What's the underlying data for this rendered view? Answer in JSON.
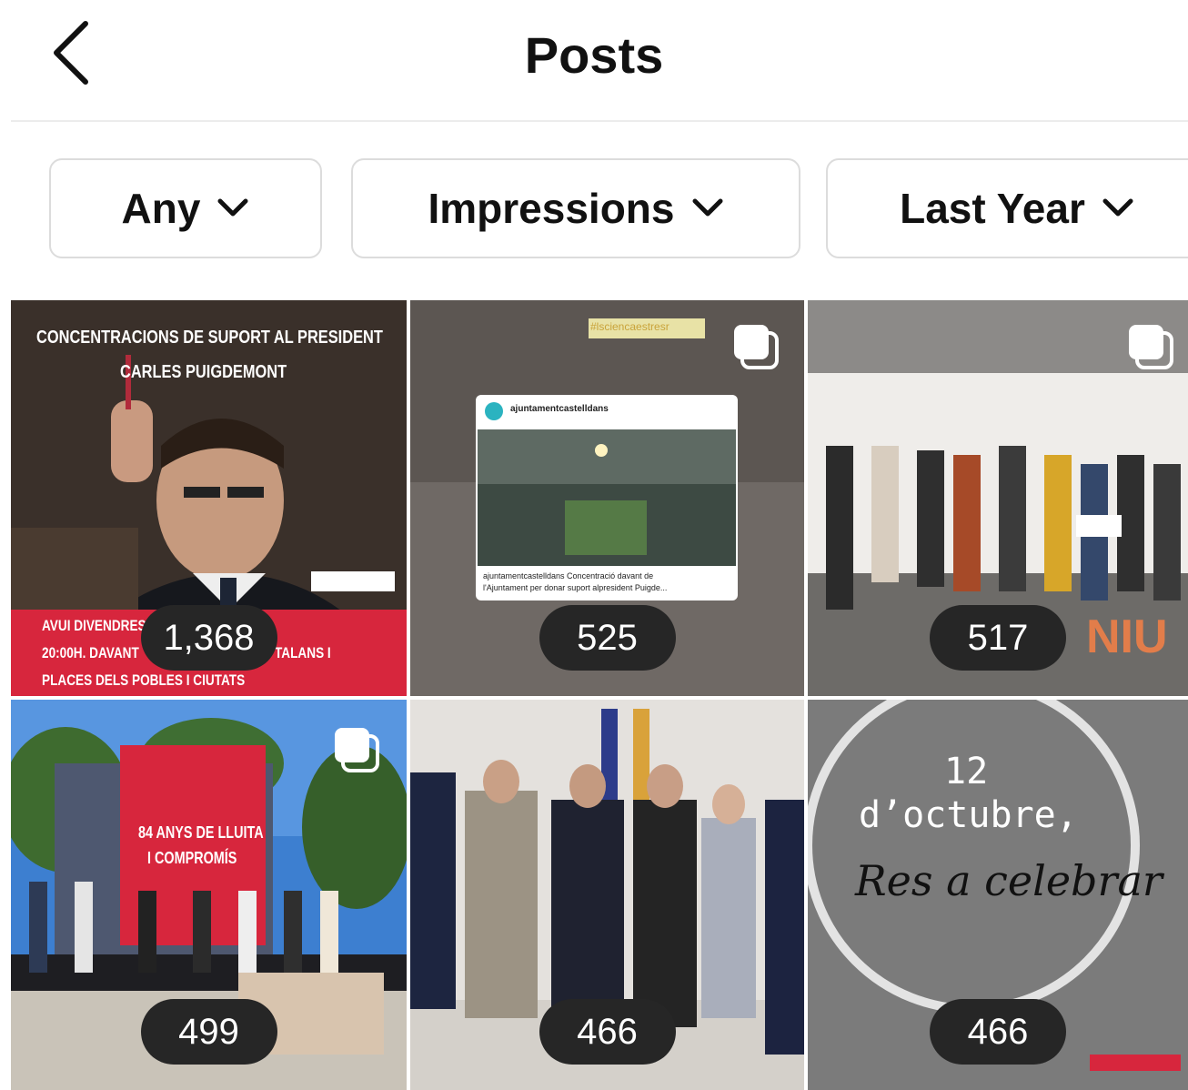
{
  "header": {
    "title": "Posts"
  },
  "filters": [
    {
      "label": "Any"
    },
    {
      "label": "Impressions"
    },
    {
      "label": "Last Year"
    }
  ],
  "posts": [
    {
      "count": "1,368",
      "text": {
        "headline1": "CONCENTRACIONS DE SUPORT AL PRESIDENT",
        "headline2": "CARLES PUIGDEMONT",
        "footer1": "AVUI DIVENDRES",
        "footer2a": "20:00H. DAVANT",
        "footer2b": "TALANS I",
        "footer3": "PLACES DELS POBLES I CIUTATS"
      }
    },
    {
      "count": "525",
      "text": {
        "tag": "#lsciencaestresr",
        "account": "ajuntamentcastelldans",
        "caption1": "ajuntamentcastelldans Concentració davant de",
        "caption2": "l'Ajuntament per donar suport alpresident Puigde..."
      }
    },
    {
      "count": "517",
      "text": {
        "sign": "NIU"
      }
    },
    {
      "count": "499",
      "text": {
        "banner1": "84 ANYS DE LLUITA",
        "banner2": "I COMPROMÍS"
      }
    },
    {
      "count": "466",
      "text": {}
    },
    {
      "count": "466",
      "text": {
        "line1": "12",
        "line2": "d’octubre,",
        "line3": "Res a celebrar"
      }
    }
  ],
  "colors": {
    "badge_bg": "#262626",
    "red": "#d7263d",
    "grey_tile": "#7b7b7b"
  }
}
